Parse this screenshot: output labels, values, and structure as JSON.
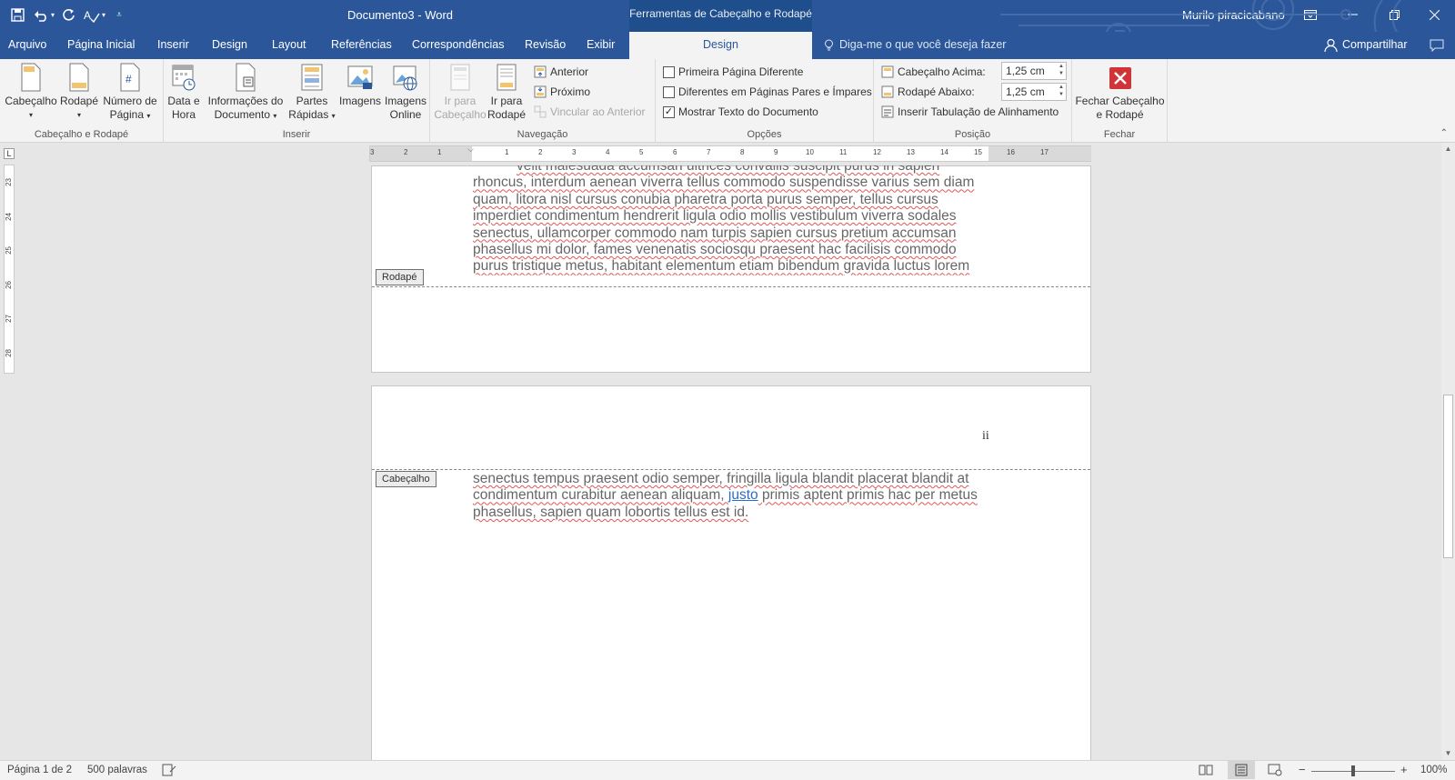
{
  "titlebar": {
    "doc_title": "Documento3  -  Word",
    "context_tab": "Ferramentas de Cabeçalho e Rodapé",
    "user": "Murilo piracicabano",
    "qat_icons": [
      "save-icon",
      "undo-icon",
      "redo-icon",
      "spelling-icon",
      "customize-icon"
    ],
    "window_icons": [
      "ribbon-options-icon",
      "minimize-icon",
      "restore-icon",
      "close-icon"
    ]
  },
  "tabs": {
    "items": [
      "Arquivo",
      "Página Inicial",
      "Inserir",
      "Design",
      "Layout",
      "Referências",
      "Correspondências",
      "Revisão",
      "Exibir"
    ],
    "active": "Design",
    "tell_me": "Diga-me o que você deseja fazer",
    "share": "Compartilhar"
  },
  "ribbon": {
    "groups": {
      "header_footer": "Cabeçalho e Rodapé",
      "insert": "Inserir",
      "navigation": "Navegação",
      "options": "Opções",
      "position": "Posição",
      "close": "Fechar"
    },
    "header_btn": "Cabeçalho",
    "footer_btn": "Rodapé",
    "pagenum_btn_1": "Número de",
    "pagenum_btn_2": "Página",
    "date_btn_1": "Data e",
    "date_btn_2": "Hora",
    "docinfo_btn_1": "Informações do",
    "docinfo_btn_2": "Documento",
    "quickparts_btn_1": "Partes",
    "quickparts_btn_2": "Rápidas",
    "images_btn": "Imagens",
    "online_btn_1": "Imagens",
    "online_btn_2": "Online",
    "goto_header_1": "Ir para",
    "goto_header_2": "Cabeçalho",
    "goto_footer_1": "Ir para",
    "goto_footer_2": "Rodapé",
    "previous": "Anterior",
    "next": "Próximo",
    "link_previous": "Vincular ao Anterior",
    "opt_first_page": "Primeira Página Diferente",
    "opt_odd_even": "Diferentes em Páginas Pares e Ímpares",
    "opt_show_text": "Mostrar Texto do Documento",
    "opt_first_page_checked": false,
    "opt_odd_even_checked": false,
    "opt_show_text_checked": true,
    "header_top_label": "Cabeçalho Acima:",
    "header_top_value": "1,25 cm",
    "footer_bottom_label": "Rodapé Abaixo:",
    "footer_bottom_value": "1,25 cm",
    "insert_tab": "Inserir Tabulação de Alinhamento",
    "close_btn_1": "Fechar Cabeçalho",
    "close_btn_2": "e Rodapé"
  },
  "ruler": {
    "h_ticks": [
      "3",
      "2",
      "1",
      "1",
      "2",
      "3",
      "4",
      "5",
      "6",
      "7",
      "8",
      "9",
      "10",
      "11",
      "12",
      "13",
      "14",
      "15",
      "16",
      "17"
    ],
    "v_ticks": [
      "23",
      "24",
      "25",
      "26",
      "27",
      "28"
    ]
  },
  "page1": {
    "footer_label": "Rodapé",
    "lines": [
      "velit malesuada accumsan ultrices convallis suscipit purus in sapien",
      "rhoncus, interdum aenean viverra tellus commodo suspendisse varius sem diam",
      "quam, litora nisl cursus conubia pharetra porta purus semper, tellus cursus",
      "imperdiet condimentum hendrerit ligula odio mollis vestibulum viverra sodales",
      "senectus, ullamcorper commodo nam turpis sapien cursus pretium accumsan",
      "phasellus mi dolor, fames venenatis sociosqu praesent hac facilisis commodo",
      "purus tristique metus, habitant elementum etiam bibendum gravida luctus lorem"
    ]
  },
  "page2": {
    "header_label": "Cabeçalho",
    "page_number": "ii",
    "line1": "senectus tempus praesent odio semper, fringilla ligula blandit placerat blandit at",
    "line2a": "condimentum curabitur aenean aliquam, ",
    "line2link": "justo",
    "line2b": " primis aptent primis hac per metus",
    "line3": "phasellus, sapien quam lobortis tellus est id."
  },
  "statusbar": {
    "page": "Página 1 de 2",
    "words": "500 palavras",
    "zoom": "100%",
    "zoom_level": 1.0
  },
  "colors": {
    "brand": "#2b579a",
    "close_red": "#d13438",
    "spell_underline": "#e15656"
  }
}
